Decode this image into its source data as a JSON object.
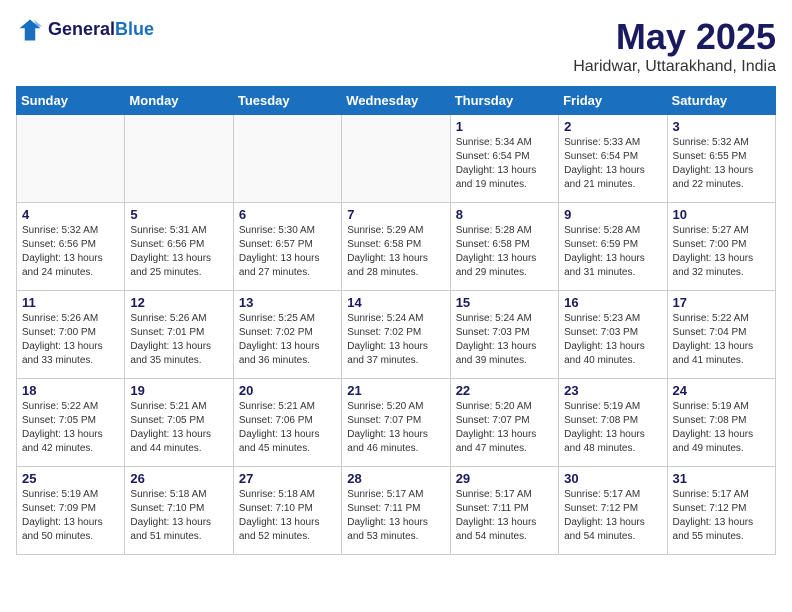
{
  "header": {
    "logo_line1": "General",
    "logo_line2": "Blue",
    "month_year": "May 2025",
    "location": "Haridwar, Uttarakhand, India"
  },
  "days_of_week": [
    "Sunday",
    "Monday",
    "Tuesday",
    "Wednesday",
    "Thursday",
    "Friday",
    "Saturday"
  ],
  "weeks": [
    [
      {
        "day": "",
        "info": ""
      },
      {
        "day": "",
        "info": ""
      },
      {
        "day": "",
        "info": ""
      },
      {
        "day": "",
        "info": ""
      },
      {
        "day": "1",
        "info": "Sunrise: 5:34 AM\nSunset: 6:54 PM\nDaylight: 13 hours\nand 19 minutes."
      },
      {
        "day": "2",
        "info": "Sunrise: 5:33 AM\nSunset: 6:54 PM\nDaylight: 13 hours\nand 21 minutes."
      },
      {
        "day": "3",
        "info": "Sunrise: 5:32 AM\nSunset: 6:55 PM\nDaylight: 13 hours\nand 22 minutes."
      }
    ],
    [
      {
        "day": "4",
        "info": "Sunrise: 5:32 AM\nSunset: 6:56 PM\nDaylight: 13 hours\nand 24 minutes."
      },
      {
        "day": "5",
        "info": "Sunrise: 5:31 AM\nSunset: 6:56 PM\nDaylight: 13 hours\nand 25 minutes."
      },
      {
        "day": "6",
        "info": "Sunrise: 5:30 AM\nSunset: 6:57 PM\nDaylight: 13 hours\nand 27 minutes."
      },
      {
        "day": "7",
        "info": "Sunrise: 5:29 AM\nSunset: 6:58 PM\nDaylight: 13 hours\nand 28 minutes."
      },
      {
        "day": "8",
        "info": "Sunrise: 5:28 AM\nSunset: 6:58 PM\nDaylight: 13 hours\nand 29 minutes."
      },
      {
        "day": "9",
        "info": "Sunrise: 5:28 AM\nSunset: 6:59 PM\nDaylight: 13 hours\nand 31 minutes."
      },
      {
        "day": "10",
        "info": "Sunrise: 5:27 AM\nSunset: 7:00 PM\nDaylight: 13 hours\nand 32 minutes."
      }
    ],
    [
      {
        "day": "11",
        "info": "Sunrise: 5:26 AM\nSunset: 7:00 PM\nDaylight: 13 hours\nand 33 minutes."
      },
      {
        "day": "12",
        "info": "Sunrise: 5:26 AM\nSunset: 7:01 PM\nDaylight: 13 hours\nand 35 minutes."
      },
      {
        "day": "13",
        "info": "Sunrise: 5:25 AM\nSunset: 7:02 PM\nDaylight: 13 hours\nand 36 minutes."
      },
      {
        "day": "14",
        "info": "Sunrise: 5:24 AM\nSunset: 7:02 PM\nDaylight: 13 hours\nand 37 minutes."
      },
      {
        "day": "15",
        "info": "Sunrise: 5:24 AM\nSunset: 7:03 PM\nDaylight: 13 hours\nand 39 minutes."
      },
      {
        "day": "16",
        "info": "Sunrise: 5:23 AM\nSunset: 7:03 PM\nDaylight: 13 hours\nand 40 minutes."
      },
      {
        "day": "17",
        "info": "Sunrise: 5:22 AM\nSunset: 7:04 PM\nDaylight: 13 hours\nand 41 minutes."
      }
    ],
    [
      {
        "day": "18",
        "info": "Sunrise: 5:22 AM\nSunset: 7:05 PM\nDaylight: 13 hours\nand 42 minutes."
      },
      {
        "day": "19",
        "info": "Sunrise: 5:21 AM\nSunset: 7:05 PM\nDaylight: 13 hours\nand 44 minutes."
      },
      {
        "day": "20",
        "info": "Sunrise: 5:21 AM\nSunset: 7:06 PM\nDaylight: 13 hours\nand 45 minutes."
      },
      {
        "day": "21",
        "info": "Sunrise: 5:20 AM\nSunset: 7:07 PM\nDaylight: 13 hours\nand 46 minutes."
      },
      {
        "day": "22",
        "info": "Sunrise: 5:20 AM\nSunset: 7:07 PM\nDaylight: 13 hours\nand 47 minutes."
      },
      {
        "day": "23",
        "info": "Sunrise: 5:19 AM\nSunset: 7:08 PM\nDaylight: 13 hours\nand 48 minutes."
      },
      {
        "day": "24",
        "info": "Sunrise: 5:19 AM\nSunset: 7:08 PM\nDaylight: 13 hours\nand 49 minutes."
      }
    ],
    [
      {
        "day": "25",
        "info": "Sunrise: 5:19 AM\nSunset: 7:09 PM\nDaylight: 13 hours\nand 50 minutes."
      },
      {
        "day": "26",
        "info": "Sunrise: 5:18 AM\nSunset: 7:10 PM\nDaylight: 13 hours\nand 51 minutes."
      },
      {
        "day": "27",
        "info": "Sunrise: 5:18 AM\nSunset: 7:10 PM\nDaylight: 13 hours\nand 52 minutes."
      },
      {
        "day": "28",
        "info": "Sunrise: 5:17 AM\nSunset: 7:11 PM\nDaylight: 13 hours\nand 53 minutes."
      },
      {
        "day": "29",
        "info": "Sunrise: 5:17 AM\nSunset: 7:11 PM\nDaylight: 13 hours\nand 54 minutes."
      },
      {
        "day": "30",
        "info": "Sunrise: 5:17 AM\nSunset: 7:12 PM\nDaylight: 13 hours\nand 54 minutes."
      },
      {
        "day": "31",
        "info": "Sunrise: 5:17 AM\nSunset: 7:12 PM\nDaylight: 13 hours\nand 55 minutes."
      }
    ]
  ]
}
